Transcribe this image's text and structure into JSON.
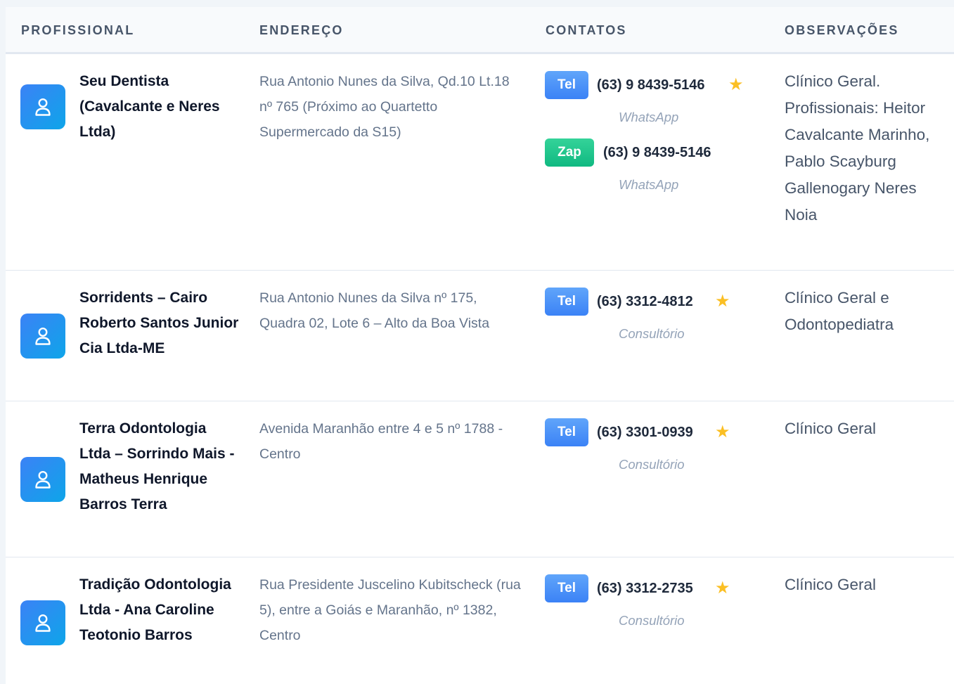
{
  "header": {
    "col_professional": "PROFISSIONAL",
    "col_address": "ENDEREÇO",
    "col_contacts": "CONTATOS",
    "col_notes": "OBSERVAÇÕES"
  },
  "colors": {
    "tel_badge": "#3b82f6",
    "zap_badge": "#10b981",
    "star": "#fbbf24",
    "avatar": "#3b82f6"
  },
  "rows": [
    {
      "icon": "user-icon",
      "name": "Seu Dentista (Cavalcante e Neres Ltda)",
      "address": "Rua Antonio Nunes da Silva, Qd.10 Lt.18 nº 765 (Próximo ao Quartetto Supermercado da S15)",
      "contacts": [
        {
          "badge": "Tel",
          "phone": "(63) 9 8439-5146",
          "star": "★",
          "type": "WhatsApp"
        },
        {
          "badge": "Zap",
          "phone": "(63) 9 8439-5146",
          "type": "WhatsApp"
        }
      ],
      "notes": "Clínico Geral. Profissionais: Heitor Cavalcante Marinho, Pablo Scayburg Gallenogary Neres Noia"
    },
    {
      "icon": "user-icon",
      "name": "Sorridents – Cairo Roberto Santos Junior Cia Ltda-ME",
      "address": "Rua Antonio Nunes da Silva nº 175, Quadra 02, Lote 6 – Alto da Boa Vista",
      "contacts": [
        {
          "badge": "Tel",
          "phone": "(63) 3312-4812",
          "star": "★",
          "type": "Consultório"
        }
      ],
      "notes": "Clínico Geral e Odontopediatra"
    },
    {
      "icon": "user-icon",
      "name": "Terra Odontologia Ltda – Sorrindo Mais - Matheus Henrique Barros Terra",
      "address": "Avenida Maranhão entre 4 e 5 nº 1788 - Centro",
      "contacts": [
        {
          "badge": "Tel",
          "phone": "(63) 3301-0939",
          "star": "★",
          "type": "Consultório"
        }
      ],
      "notes": "Clínico Geral"
    },
    {
      "icon": "user-icon",
      "name": "Tradição Odontologia Ltda - Ana Caroline Teotonio Barros",
      "address": "Rua Presidente Juscelino Kubitscheck (rua 5), entre a Goiás e Maranhão, nº 1382, Centro",
      "contacts": [
        {
          "badge": "Tel",
          "phone": "(63) 3312-2735",
          "star": "★",
          "type": "Consultório"
        }
      ],
      "notes": "Clínico Geral"
    }
  ]
}
